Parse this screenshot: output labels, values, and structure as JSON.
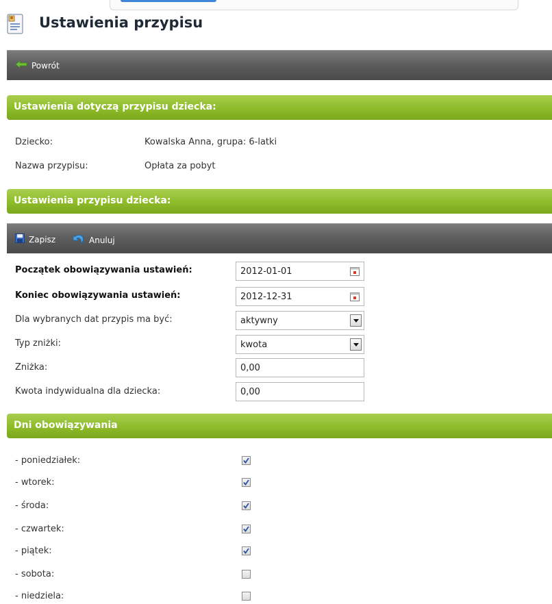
{
  "header": {
    "title": "Ustawienia przypisu",
    "icon": "document-user-icon"
  },
  "toolbar_back": {
    "label": "Powrót",
    "icon": "arrow-left-icon"
  },
  "section1": {
    "title": "Ustawienia dotyczą przypisu dziecka:",
    "rows": [
      {
        "label": "Dziecko:",
        "value": "Kowalska Anna, grupa: 6-latki"
      },
      {
        "label": "Nazwa przypisu:",
        "value": "Opłata za pobyt"
      }
    ]
  },
  "section2": {
    "title": "Ustawienia przypisu dziecka:"
  },
  "toolbar_edit": {
    "save_label": "Zapisz",
    "save_icon": "save-icon",
    "cancel_label": "Anuluj",
    "cancel_icon": "undo-icon"
  },
  "form": {
    "start_label": "Początek obowiązywania ustawień:",
    "start_value": "2012-01-01",
    "end_label": "Koniec obowiązywania ustawień:",
    "end_value": "2012-12-31",
    "state_label": "Dla wybranych dat przypis ma być:",
    "state_value": "aktywny",
    "discount_type_label": "Typ zniżki:",
    "discount_type_value": "kwota",
    "discount_label": "Zniżka:",
    "discount_value": "0,00",
    "individual_label": "Kwota indywidualna dla dziecka:",
    "individual_value": "0,00"
  },
  "section3": {
    "title": "Dni obowiązywania",
    "days": [
      {
        "label": "- poniedziałek:",
        "checked": true
      },
      {
        "label": "- wtorek:",
        "checked": true
      },
      {
        "label": "- środa:",
        "checked": true
      },
      {
        "label": "- czwartek:",
        "checked": true
      },
      {
        "label": "- piątek:",
        "checked": true
      },
      {
        "label": "- sobota:",
        "checked": false
      },
      {
        "label": "- niedziela:",
        "checked": false
      }
    ]
  },
  "colors": {
    "green_bar": "#8dbb2a",
    "dark_bar": "#5e5e5e",
    "accent_blue": "#3f86d8"
  }
}
